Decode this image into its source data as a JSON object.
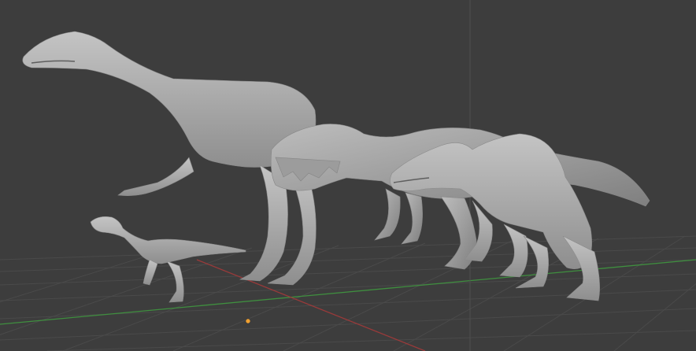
{
  "viewport": {
    "background": "#3d3d3d",
    "grid_color": "#4a4a4a",
    "x_axis_color": "#9a3a3a",
    "y_axis_color": "#3f8f3f",
    "z_axis_color": "#5a5a5a",
    "model_color": "#b4b4b4",
    "origin_marker_color": "#f0a030"
  },
  "objects": [
    {
      "name": "small-theropod-model"
    },
    {
      "name": "long-neck-theropod-model"
    },
    {
      "name": "large-theropod-model"
    },
    {
      "name": "crested-theropod-model"
    }
  ]
}
